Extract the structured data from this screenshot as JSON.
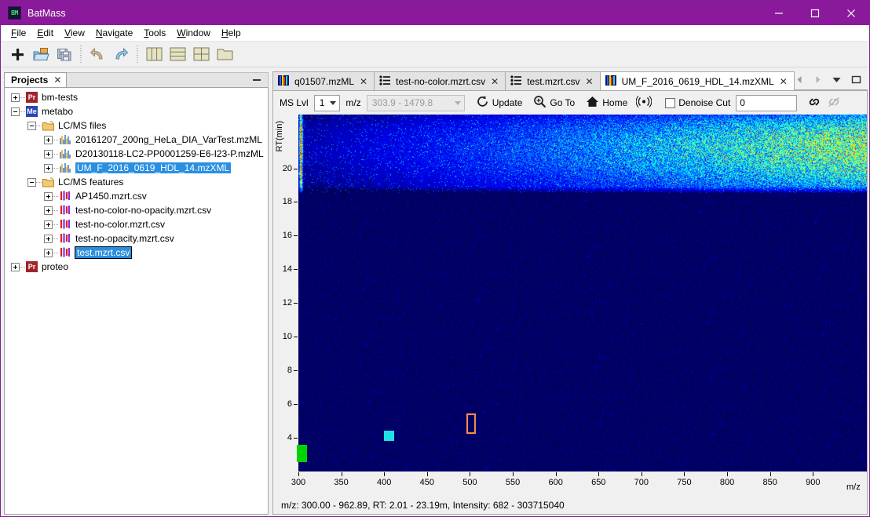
{
  "window": {
    "title": "BatMass",
    "app_icon": "batmass-logo-icon",
    "minimize": "minimize-icon",
    "maximize": "maximize-icon",
    "close": "close-icon"
  },
  "menubar": {
    "items": [
      {
        "label": "File",
        "mnemonic": "F"
      },
      {
        "label": "Edit",
        "mnemonic": "E"
      },
      {
        "label": "View",
        "mnemonic": "V"
      },
      {
        "label": "Navigate",
        "mnemonic": "N"
      },
      {
        "label": "Tools",
        "mnemonic": "T"
      },
      {
        "label": "Window",
        "mnemonic": "W"
      },
      {
        "label": "Help",
        "mnemonic": "H"
      }
    ]
  },
  "toolbar": {
    "buttons": [
      {
        "name": "new-project-button",
        "icon": "plus-icon"
      },
      {
        "name": "open-project-button",
        "icon": "open-folder-icon"
      },
      {
        "name": "save-all-button",
        "icon": "save-all-icon"
      },
      {
        "name": "undo-button",
        "icon": "undo-arrow-icon"
      },
      {
        "name": "redo-button",
        "icon": "redo-arrow-icon"
      },
      {
        "name": "split-vertical-button",
        "icon": "columns-layout-icon"
      },
      {
        "name": "split-horizontal-button",
        "icon": "rows-layout-icon"
      },
      {
        "name": "grid-layout-button",
        "icon": "grid-layout-icon"
      },
      {
        "name": "folder-button",
        "icon": "folder-icon"
      }
    ]
  },
  "projects_panel": {
    "tab_label": "Projects",
    "close_icon": "close-icon",
    "minimize_icon": "minimize-panel-icon",
    "tree": [
      {
        "label": "bm-tests",
        "type": "project",
        "badge": "Pr",
        "indent": 0,
        "expander": "plus",
        "selected": false
      },
      {
        "label": "metabo",
        "type": "project",
        "badge": "Me",
        "indent": 0,
        "expander": "minus",
        "selected": false
      },
      {
        "label": "LC/MS files",
        "type": "folder",
        "indent": 1,
        "expander": "minus",
        "selected": false
      },
      {
        "label": "20161207_200ng_HeLa_DIA_VarTest.mzML",
        "type": "spectrum",
        "indent": 2,
        "expander": "plus",
        "selected": false
      },
      {
        "label": "D20130118-LC2-PP0001259-E6-I23-P.mzML",
        "type": "spectrum",
        "indent": 2,
        "expander": "plus",
        "selected": false
      },
      {
        "label": "UM_F_2016_0619_HDL_14.mzXML",
        "type": "spectrum",
        "indent": 2,
        "expander": "plus",
        "selected": true
      },
      {
        "label": "LC/MS features",
        "type": "folder",
        "indent": 1,
        "expander": "minus",
        "selected": false
      },
      {
        "label": "AP1450.mzrt.csv",
        "type": "feature",
        "indent": 2,
        "expander": "plus",
        "selected": false
      },
      {
        "label": "test-no-color-no-opacity.mzrt.csv",
        "type": "feature",
        "indent": 2,
        "expander": "plus",
        "selected": false
      },
      {
        "label": "test-no-color.mzrt.csv",
        "type": "feature",
        "indent": 2,
        "expander": "plus",
        "selected": false
      },
      {
        "label": "test-no-opacity.mzrt.csv",
        "type": "feature",
        "indent": 2,
        "expander": "plus",
        "selected": false
      },
      {
        "label": "test.mzrt.csv",
        "type": "feature",
        "indent": 2,
        "expander": "plus",
        "selected": true,
        "focus_box": true
      },
      {
        "label": "proteo",
        "type": "project",
        "badge": "Pr",
        "indent": 0,
        "expander": "plus",
        "selected": false
      }
    ]
  },
  "editor": {
    "tabs": [
      {
        "label": "q01507.mzML",
        "icon": "heatmap-icon",
        "active": false,
        "close_icon": "close-icon"
      },
      {
        "label": "test-no-color.mzrt.csv",
        "icon": "list-icon",
        "active": false,
        "close_icon": "close-icon"
      },
      {
        "label": "test.mzrt.csv",
        "icon": "list-icon",
        "active": false,
        "close_icon": "close-icon"
      },
      {
        "label": "UM_F_2016_0619_HDL_14.mzXML",
        "icon": "heatmap-icon",
        "active": true,
        "close_icon": "close-icon"
      }
    ],
    "tab_controls": [
      {
        "name": "scroll-tabs-left-button",
        "icon": "chevron-left-icon"
      },
      {
        "name": "scroll-tabs-right-button",
        "icon": "chevron-right-icon"
      },
      {
        "name": "tab-list-dropdown-button",
        "icon": "chevron-down-icon"
      },
      {
        "name": "maximize-editor-button",
        "icon": "maximize-icon"
      }
    ],
    "ms_toolbar": {
      "ms_level_label": "MS Lvl",
      "ms_level_value": "1",
      "mz_label": "m/z",
      "mz_range_value": "303.9 - 1479.8",
      "update_label": "Update",
      "update_icon": "refresh-icon",
      "goto_label": "Go To",
      "goto_icon": "zoom-search-icon",
      "home_label": "Home",
      "home_icon": "home-icon",
      "signal_icon": "broadcast-signal-icon",
      "denoise_label": "Denoise Cut",
      "denoise_checked": false,
      "denoise_value": "0",
      "link_icon": "chain-link-icon",
      "unlink_icon": "chain-broken-icon"
    },
    "status_text": "m/z: 300.00 - 962.89, RT: 2.01 - 23.19m, Intensity: 682 - 303715040"
  },
  "chart_data": {
    "type": "heatmap",
    "title": "",
    "xlabel": "m/z",
    "ylabel": "RT(min)",
    "xlim": [
      300.0,
      962.89
    ],
    "ylim": [
      2.01,
      23.19
    ],
    "xticks": [
      300,
      350,
      400,
      450,
      500,
      550,
      600,
      650,
      700,
      750,
      800,
      850,
      900
    ],
    "yticks": [
      20,
      18,
      16,
      14,
      12,
      10,
      8,
      6,
      4
    ],
    "intensity_range": [
      682,
      303715040
    ],
    "colormap": "jet",
    "background": "#000060",
    "grid": false,
    "legend": false,
    "signal_band_rt": [
      18.6,
      23.19
    ],
    "feature_overlays": [
      {
        "name": "green-feature-box",
        "color": "#00d400",
        "mz": 304.0,
        "rt_center": 3.1,
        "filled": true
      },
      {
        "name": "cyan-feature-box",
        "color": "#1ee0e8",
        "mz": 406.0,
        "rt_center": 4.15,
        "filled": true
      },
      {
        "name": "orange-feature-box",
        "color": "#f58b4c",
        "mz": 501.0,
        "rt_center": 4.85,
        "filled": false
      }
    ]
  }
}
